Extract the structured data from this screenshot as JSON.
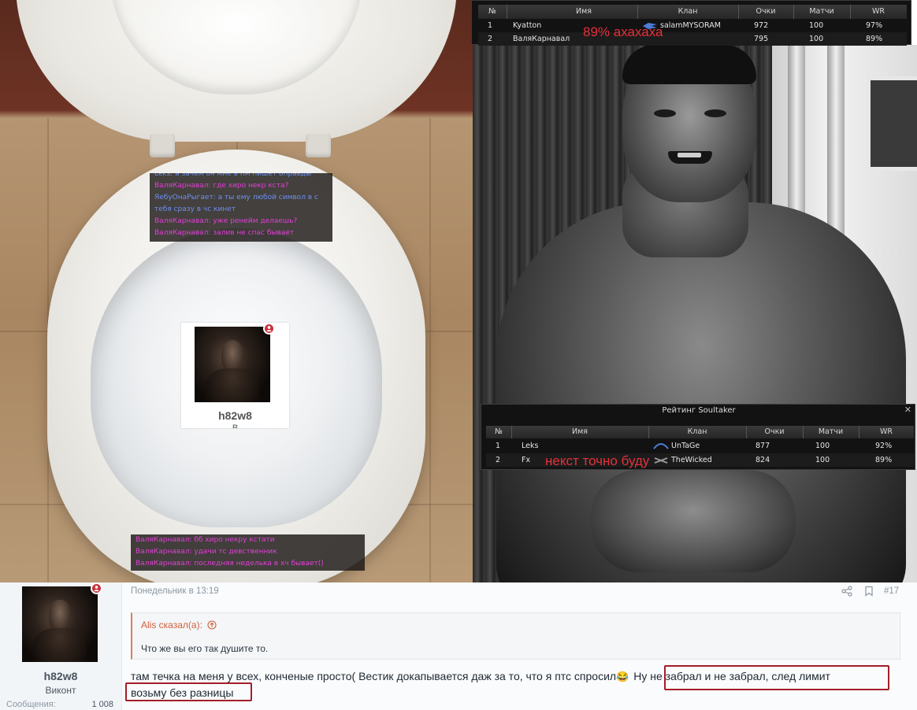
{
  "chat_top": [
    {
      "text": "Leks: а зачем он мне в пм пишет оправды",
      "color": "blue"
    },
    {
      "text": "ВаляКарнавал: где хиро некр кста?",
      "color": "pink"
    },
    {
      "text": "ЯебуОнаРыгает: а ты ему любой символ в с",
      "color": "blue"
    },
    {
      "text": " тебя сразу в чс кинет",
      "color": "blue"
    },
    {
      "text": "ВаляКарнавал: уже ренейм делаешь?",
      "color": "pink"
    },
    {
      "text": "ВаляКарнавал: залив не спас бывает",
      "color": "pink"
    }
  ],
  "chat_bottom": [
    {
      "text": "ВаляКарнавал: бб хиро некру кстати",
      "color": "pink"
    },
    {
      "text": "ВаляКарнавал: удачи тс девственник",
      "color": "pink"
    },
    {
      "text": "ВаляКарнавал: последняя неделька в хч бывает()",
      "color": "pink"
    }
  ],
  "overlay_card": {
    "username": "h82w8",
    "subtitle": "В"
  },
  "table_top": {
    "headers": [
      "№",
      "Имя",
      "Клан",
      "Очки",
      "Матчи",
      "WR"
    ],
    "rows": [
      [
        "1",
        "Kyatton",
        "salamMYSORAM",
        "972",
        "100",
        "97%"
      ],
      [
        "2",
        "ВаляКарнавал",
        "",
        "795",
        "100",
        "89%"
      ]
    ]
  },
  "table_bottom": {
    "title": "Рейтинг Soultaker",
    "close": "✕",
    "headers": [
      "№",
      "Имя",
      "Клан",
      "Очки",
      "Матчи",
      "WR"
    ],
    "rows": [
      [
        "1",
        "Leks",
        "UnTaGe",
        "877",
        "100",
        "92%"
      ],
      [
        "2",
        "Fx",
        "TheWicked",
        "824",
        "100",
        "89%"
      ]
    ]
  },
  "overlay_texts": {
    "top": "89% ахахаха",
    "bottom": "некст точно буду"
  },
  "post": {
    "timestamp": "Понедельник в 13:19",
    "number": "#17",
    "author": "h82w8",
    "rank": "Виконт",
    "stat_label": "Сообщения:",
    "stat_value": "1 008",
    "quote_author": "Alis сказал(а):",
    "quote_text": "Что же вы его так душите то.",
    "message_part1": "там течка на меня у всех, конченые просто( Вестик докапывается даж за то, что я птс спросил",
    "emoji": "😂",
    "message_part2": "Ну не забрал и не забрал, след лимит",
    "message_line2": "возьму без разницы"
  },
  "colors": {
    "chat_pink": "#e33fd8",
    "chat_blue": "#6f8ff0",
    "overlay_red": "#e5313a",
    "box_red": "#a31e2a",
    "badge_red": "#c8303a",
    "quote_accent": "#e07b5a"
  }
}
